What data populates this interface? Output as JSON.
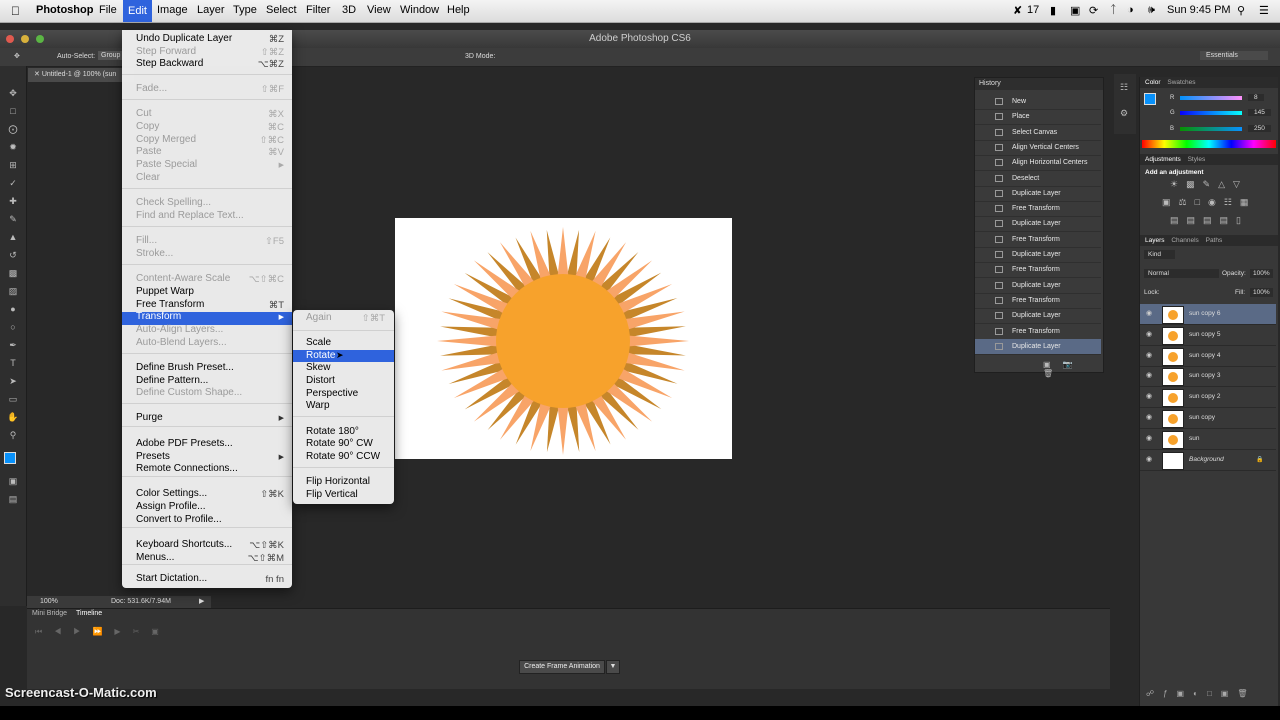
{
  "menubar": {
    "items": [
      "Photoshop",
      "File",
      "Edit",
      "Image",
      "Layer",
      "Type",
      "Select",
      "Filter",
      "3D",
      "View",
      "Window",
      "Help"
    ],
    "status": [
      "17",
      "Sun 9:45 PM"
    ]
  },
  "window": {
    "title": "Adobe Photoshop CS6",
    "doc_tab": "Untitled-1 @ 100% (sun",
    "workspace": "Essentials"
  },
  "options": {
    "auto_select": "Auto-Select:",
    "group": "Group",
    "mode_3d": "3D Mode:"
  },
  "edit_menu": {
    "items": [
      {
        "label": "Undo Duplicate Layer",
        "shortcut": "⌘Z",
        "enabled": true
      },
      {
        "label": "Step Forward",
        "shortcut": "⇧⌘Z",
        "enabled": false
      },
      {
        "label": "Step Backward",
        "shortcut": "⌥⌘Z",
        "enabled": true
      },
      {
        "label": "Fade...",
        "shortcut": "⇧⌘F",
        "enabled": false
      },
      {
        "label": "Cut",
        "shortcut": "⌘X",
        "enabled": false
      },
      {
        "label": "Copy",
        "shortcut": "⌘C",
        "enabled": false
      },
      {
        "label": "Copy Merged",
        "shortcut": "⇧⌘C",
        "enabled": false
      },
      {
        "label": "Paste",
        "shortcut": "⌘V",
        "enabled": false
      },
      {
        "label": "Paste Special",
        "shortcut": "",
        "enabled": false
      },
      {
        "label": "Clear",
        "shortcut": "",
        "enabled": false
      },
      {
        "label": "Check Spelling...",
        "shortcut": "",
        "enabled": false
      },
      {
        "label": "Find and Replace Text...",
        "shortcut": "",
        "enabled": false
      },
      {
        "label": "Fill...",
        "shortcut": "⇧F5",
        "enabled": false
      },
      {
        "label": "Stroke...",
        "shortcut": "",
        "enabled": false
      },
      {
        "label": "Content-Aware Scale",
        "shortcut": "⌥⇧⌘C",
        "enabled": false
      },
      {
        "label": "Puppet Warp",
        "shortcut": "",
        "enabled": true
      },
      {
        "label": "Free Transform",
        "shortcut": "⌘T",
        "enabled": true
      },
      {
        "label": "Transform",
        "shortcut": "",
        "enabled": true
      },
      {
        "label": "Auto-Align Layers...",
        "shortcut": "",
        "enabled": false
      },
      {
        "label": "Auto-Blend Layers...",
        "shortcut": "",
        "enabled": false
      },
      {
        "label": "Define Brush Preset...",
        "shortcut": "",
        "enabled": true
      },
      {
        "label": "Define Pattern...",
        "shortcut": "",
        "enabled": true
      },
      {
        "label": "Define Custom Shape...",
        "shortcut": "",
        "enabled": false
      },
      {
        "label": "Purge",
        "shortcut": "",
        "enabled": true
      },
      {
        "label": "Adobe PDF Presets...",
        "shortcut": "",
        "enabled": true
      },
      {
        "label": "Presets",
        "shortcut": "",
        "enabled": true
      },
      {
        "label": "Remote Connections...",
        "shortcut": "",
        "enabled": true
      },
      {
        "label": "Color Settings...",
        "shortcut": "⇧⌘K",
        "enabled": true
      },
      {
        "label": "Assign Profile...",
        "shortcut": "",
        "enabled": true
      },
      {
        "label": "Convert to Profile...",
        "shortcut": "",
        "enabled": true
      },
      {
        "label": "Keyboard Shortcuts...",
        "shortcut": "⌥⇧⌘K",
        "enabled": true
      },
      {
        "label": "Menus...",
        "shortcut": "⌥⇧⌘M",
        "enabled": true
      },
      {
        "label": "Start Dictation...",
        "shortcut": "fn fn",
        "enabled": true
      }
    ]
  },
  "transform_submenu": {
    "items": [
      {
        "label": "Again",
        "shortcut": "⇧⌘T",
        "enabled": false
      },
      {
        "label": "Scale",
        "enabled": true
      },
      {
        "label": "Rotate",
        "enabled": true
      },
      {
        "label": "Skew",
        "enabled": true
      },
      {
        "label": "Distort",
        "enabled": true
      },
      {
        "label": "Perspective",
        "enabled": true
      },
      {
        "label": "Warp",
        "enabled": true
      },
      {
        "label": "Rotate 180°",
        "enabled": true
      },
      {
        "label": "Rotate 90° CW",
        "enabled": true
      },
      {
        "label": "Rotate 90° CCW",
        "enabled": true
      },
      {
        "label": "Flip Horizontal",
        "enabled": true
      },
      {
        "label": "Flip Vertical",
        "enabled": true
      }
    ]
  },
  "history": {
    "title": "History",
    "items": [
      "New",
      "Place",
      "Select Canvas",
      "Align Vertical Centers",
      "Align Horizontal Centers",
      "Deselect",
      "Duplicate Layer",
      "Free Transform",
      "Duplicate Layer",
      "Free Transform",
      "Duplicate Layer",
      "Free Transform",
      "Duplicate Layer",
      "Free Transform",
      "Duplicate Layer",
      "Free Transform",
      "Duplicate Layer"
    ]
  },
  "color_panel": {
    "tabs": [
      "Color",
      "Swatches"
    ],
    "r": "8",
    "g": "145",
    "b": "250",
    "labels": [
      "R",
      "G",
      "B"
    ]
  },
  "adjustments": {
    "tabs": [
      "Adjustments",
      "Styles"
    ],
    "add_label": "Add an adjustment"
  },
  "layers": {
    "tabs": [
      "Layers",
      "Channels",
      "Paths"
    ],
    "kind": "Kind",
    "blend": "Normal",
    "opacity_label": "Opacity:",
    "opacity": "100%",
    "lock_label": "Lock:",
    "fill_label": "Fill:",
    "fill": "100%",
    "items": [
      "sun copy 6",
      "sun copy 5",
      "sun copy 4",
      "sun copy 3",
      "sun copy 2",
      "sun copy",
      "sun",
      "Background"
    ]
  },
  "status": {
    "zoom": "100%",
    "doc": "Doc: 531.6K/7.94M"
  },
  "timeline": {
    "tabs": [
      "Mini Bridge",
      "Timeline"
    ],
    "create_button": "Create Frame Animation"
  },
  "watermark": "Screencast-O-Matic.com",
  "colors": {
    "sun_fill": "#f7a22c",
    "ray_light": "#f8a468",
    "ray_dark": "#c6862a",
    "highlight": "#2f63dd",
    "foreground": "#0891fa"
  }
}
